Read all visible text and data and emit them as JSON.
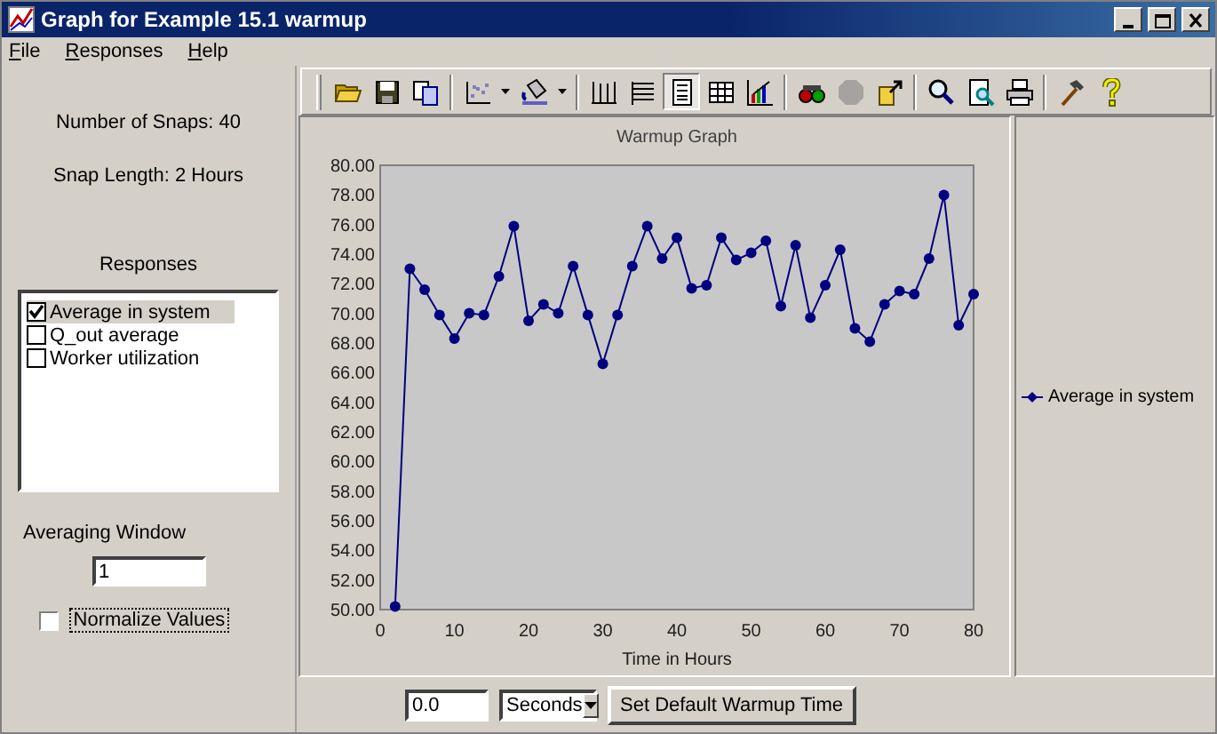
{
  "window": {
    "title": "Graph for Example 15.1 warmup"
  },
  "menu": [
    {
      "label": "File"
    },
    {
      "label": "Responses"
    },
    {
      "label": "Help"
    }
  ],
  "info": {
    "snaps": "Number of Snaps: 40",
    "snap_length": "Snap Length: 2 Hours"
  },
  "responses": {
    "heading": "Responses",
    "items": [
      {
        "label": "Average in system",
        "checked": true,
        "selected": true
      },
      {
        "label": "Q_out average",
        "checked": false,
        "selected": false
      },
      {
        "label": "Worker utilization",
        "checked": false,
        "selected": false
      }
    ]
  },
  "averaging_window": {
    "label": "Averaging Window",
    "value": "1"
  },
  "normalize": {
    "label": "Normalize Values",
    "checked": false
  },
  "toolbar": {
    "groups": [
      [
        {
          "kind": "folder",
          "pressed": false,
          "disabled": false,
          "dropdown": false
        },
        {
          "kind": "disk",
          "pressed": false,
          "disabled": false,
          "dropdown": false
        },
        {
          "kind": "copy",
          "pressed": false,
          "disabled": false,
          "dropdown": false
        }
      ],
      [
        {
          "kind": "scatter",
          "pressed": false,
          "disabled": false,
          "dropdown": true
        },
        {
          "kind": "bucket",
          "pressed": false,
          "disabled": false,
          "dropdown": true
        }
      ],
      [
        {
          "kind": "vgrid",
          "pressed": false,
          "disabled": false,
          "dropdown": false
        },
        {
          "kind": "hgrid",
          "pressed": false,
          "disabled": false,
          "dropdown": false
        },
        {
          "kind": "page",
          "pressed": true,
          "disabled": false,
          "dropdown": false
        },
        {
          "kind": "table",
          "pressed": false,
          "disabled": false,
          "dropdown": false
        },
        {
          "kind": "bars",
          "pressed": false,
          "disabled": false,
          "dropdown": false
        }
      ],
      [
        {
          "kind": "binoculars",
          "pressed": false,
          "disabled": false,
          "dropdown": false
        },
        {
          "kind": "blob",
          "pressed": false,
          "disabled": true,
          "dropdown": false
        },
        {
          "kind": "export",
          "pressed": false,
          "disabled": false,
          "dropdown": false
        }
      ],
      [
        {
          "kind": "magnifier",
          "pressed": false,
          "disabled": false,
          "dropdown": false
        },
        {
          "kind": "preview",
          "pressed": false,
          "disabled": false,
          "dropdown": false
        },
        {
          "kind": "printer",
          "pressed": false,
          "disabled": false,
          "dropdown": false
        }
      ],
      [
        {
          "kind": "hammer",
          "pressed": false,
          "disabled": false,
          "dropdown": false
        },
        {
          "kind": "question",
          "pressed": false,
          "disabled": false,
          "dropdown": false
        }
      ]
    ]
  },
  "graph": {
    "chart_data": {
      "type": "line",
      "title": "Warmup Graph",
      "xlabel": "Time in Hours",
      "x": [
        2,
        4,
        6,
        8,
        10,
        12,
        14,
        16,
        18,
        20,
        22,
        24,
        26,
        28,
        30,
        32,
        34,
        36,
        38,
        40,
        42,
        44,
        46,
        48,
        50,
        52,
        54,
        56,
        58,
        60,
        62,
        64,
        66,
        68,
        70,
        72,
        74,
        76,
        78,
        80
      ],
      "series": [
        {
          "name": "Average in system",
          "color": "#000080",
          "marker": "circle",
          "values": [
            50.2,
            73.0,
            71.6,
            69.9,
            68.3,
            70.0,
            69.9,
            72.5,
            75.9,
            69.5,
            70.6,
            70.0,
            73.2,
            69.9,
            66.6,
            69.9,
            73.2,
            75.9,
            73.7,
            75.1,
            71.7,
            71.9,
            75.1,
            73.6,
            74.1,
            74.9,
            70.5,
            74.6,
            69.7,
            71.9,
            74.3,
            69.0,
            68.1,
            70.6,
            71.5,
            71.3,
            73.7,
            78.0,
            69.2,
            71.3
          ]
        }
      ],
      "xlim": [
        0,
        80
      ],
      "ylim": [
        50,
        80
      ],
      "xticks": [
        0,
        10,
        20,
        30,
        40,
        50,
        60,
        70,
        80
      ],
      "yticks": [
        {
          "value": 50,
          "label": "50.00"
        },
        {
          "value": 52,
          "label": "52.00"
        },
        {
          "value": 54,
          "label": "54.00"
        },
        {
          "value": 56,
          "label": "56.00"
        },
        {
          "value": 58,
          "label": "58.00"
        },
        {
          "value": 60,
          "label": "60.00"
        },
        {
          "value": 62,
          "label": "62.00"
        },
        {
          "value": 64,
          "label": "64.00"
        },
        {
          "value": 66,
          "label": "66.00"
        },
        {
          "value": 68,
          "label": "68.00"
        },
        {
          "value": 70,
          "label": "70.00"
        },
        {
          "value": 72,
          "label": "72.00"
        },
        {
          "value": 74,
          "label": "74.00"
        },
        {
          "value": 76,
          "label": "76.00"
        },
        {
          "value": 78,
          "label": "78.00"
        },
        {
          "value": 80,
          "label": "80.00"
        }
      ]
    }
  },
  "warmup": {
    "time": "0.0",
    "unit": "Seconds",
    "button": "Set Default Warmup Time"
  }
}
